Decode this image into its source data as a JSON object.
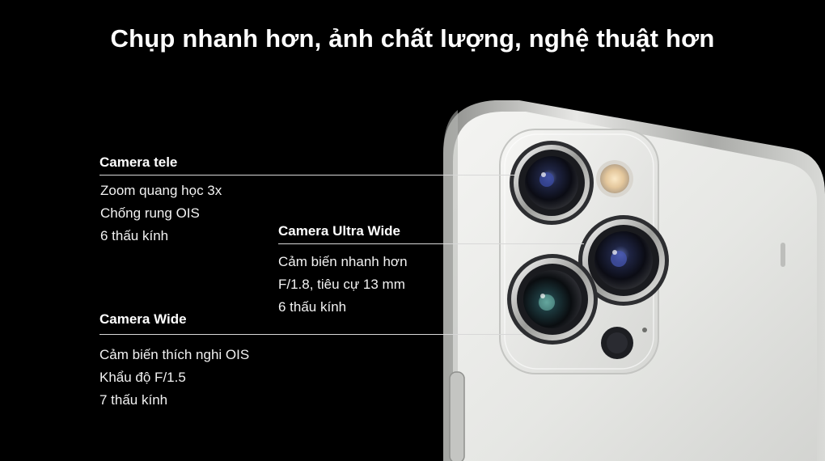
{
  "headline": "Chụp nhanh hơn, ảnh chất lượng, nghệ thuật hơn",
  "image": {
    "subject": "iphone-rear-triple-camera",
    "colors": {
      "background": "#000000",
      "body": "#e9eae8",
      "frame": "#c9cac7",
      "lens": "#1b1d2a"
    }
  },
  "specs": {
    "tele": {
      "title": "Camera tele",
      "items": [
        "Zoom quang học 3x",
        "Chống rung OIS",
        "6 thấu kính"
      ]
    },
    "ultra_wide": {
      "title": "Camera Ultra Wide",
      "items": [
        "Cảm biến nhanh hơn",
        "F/1.8, tiêu cự 13 mm",
        "6 thấu kính"
      ]
    },
    "wide": {
      "title": "Camera Wide",
      "items": [
        "Cảm biến thích nghi OIS",
        "Khẩu độ F/1.5",
        "7 thấu kính"
      ]
    }
  }
}
